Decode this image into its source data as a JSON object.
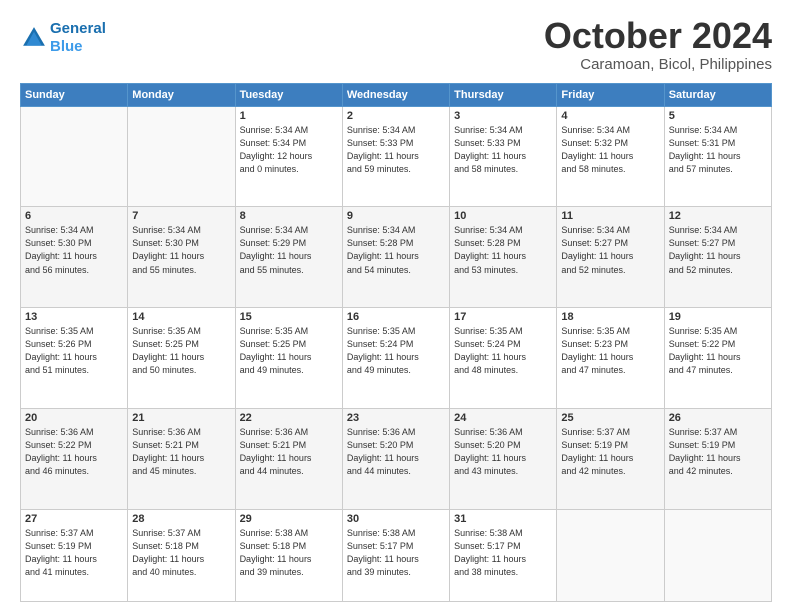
{
  "header": {
    "logo_line1": "General",
    "logo_line2": "Blue",
    "month": "October 2024",
    "location": "Caramoan, Bicol, Philippines"
  },
  "days_of_week": [
    "Sunday",
    "Monday",
    "Tuesday",
    "Wednesday",
    "Thursday",
    "Friday",
    "Saturday"
  ],
  "weeks": [
    [
      {
        "day": "",
        "info": ""
      },
      {
        "day": "",
        "info": ""
      },
      {
        "day": "1",
        "info": "Sunrise: 5:34 AM\nSunset: 5:34 PM\nDaylight: 12 hours\nand 0 minutes."
      },
      {
        "day": "2",
        "info": "Sunrise: 5:34 AM\nSunset: 5:33 PM\nDaylight: 11 hours\nand 59 minutes."
      },
      {
        "day": "3",
        "info": "Sunrise: 5:34 AM\nSunset: 5:33 PM\nDaylight: 11 hours\nand 58 minutes."
      },
      {
        "day": "4",
        "info": "Sunrise: 5:34 AM\nSunset: 5:32 PM\nDaylight: 11 hours\nand 58 minutes."
      },
      {
        "day": "5",
        "info": "Sunrise: 5:34 AM\nSunset: 5:31 PM\nDaylight: 11 hours\nand 57 minutes."
      }
    ],
    [
      {
        "day": "6",
        "info": "Sunrise: 5:34 AM\nSunset: 5:30 PM\nDaylight: 11 hours\nand 56 minutes."
      },
      {
        "day": "7",
        "info": "Sunrise: 5:34 AM\nSunset: 5:30 PM\nDaylight: 11 hours\nand 55 minutes."
      },
      {
        "day": "8",
        "info": "Sunrise: 5:34 AM\nSunset: 5:29 PM\nDaylight: 11 hours\nand 55 minutes."
      },
      {
        "day": "9",
        "info": "Sunrise: 5:34 AM\nSunset: 5:28 PM\nDaylight: 11 hours\nand 54 minutes."
      },
      {
        "day": "10",
        "info": "Sunrise: 5:34 AM\nSunset: 5:28 PM\nDaylight: 11 hours\nand 53 minutes."
      },
      {
        "day": "11",
        "info": "Sunrise: 5:34 AM\nSunset: 5:27 PM\nDaylight: 11 hours\nand 52 minutes."
      },
      {
        "day": "12",
        "info": "Sunrise: 5:34 AM\nSunset: 5:27 PM\nDaylight: 11 hours\nand 52 minutes."
      }
    ],
    [
      {
        "day": "13",
        "info": "Sunrise: 5:35 AM\nSunset: 5:26 PM\nDaylight: 11 hours\nand 51 minutes."
      },
      {
        "day": "14",
        "info": "Sunrise: 5:35 AM\nSunset: 5:25 PM\nDaylight: 11 hours\nand 50 minutes."
      },
      {
        "day": "15",
        "info": "Sunrise: 5:35 AM\nSunset: 5:25 PM\nDaylight: 11 hours\nand 49 minutes."
      },
      {
        "day": "16",
        "info": "Sunrise: 5:35 AM\nSunset: 5:24 PM\nDaylight: 11 hours\nand 49 minutes."
      },
      {
        "day": "17",
        "info": "Sunrise: 5:35 AM\nSunset: 5:24 PM\nDaylight: 11 hours\nand 48 minutes."
      },
      {
        "day": "18",
        "info": "Sunrise: 5:35 AM\nSunset: 5:23 PM\nDaylight: 11 hours\nand 47 minutes."
      },
      {
        "day": "19",
        "info": "Sunrise: 5:35 AM\nSunset: 5:22 PM\nDaylight: 11 hours\nand 47 minutes."
      }
    ],
    [
      {
        "day": "20",
        "info": "Sunrise: 5:36 AM\nSunset: 5:22 PM\nDaylight: 11 hours\nand 46 minutes."
      },
      {
        "day": "21",
        "info": "Sunrise: 5:36 AM\nSunset: 5:21 PM\nDaylight: 11 hours\nand 45 minutes."
      },
      {
        "day": "22",
        "info": "Sunrise: 5:36 AM\nSunset: 5:21 PM\nDaylight: 11 hours\nand 44 minutes."
      },
      {
        "day": "23",
        "info": "Sunrise: 5:36 AM\nSunset: 5:20 PM\nDaylight: 11 hours\nand 44 minutes."
      },
      {
        "day": "24",
        "info": "Sunrise: 5:36 AM\nSunset: 5:20 PM\nDaylight: 11 hours\nand 43 minutes."
      },
      {
        "day": "25",
        "info": "Sunrise: 5:37 AM\nSunset: 5:19 PM\nDaylight: 11 hours\nand 42 minutes."
      },
      {
        "day": "26",
        "info": "Sunrise: 5:37 AM\nSunset: 5:19 PM\nDaylight: 11 hours\nand 42 minutes."
      }
    ],
    [
      {
        "day": "27",
        "info": "Sunrise: 5:37 AM\nSunset: 5:19 PM\nDaylight: 11 hours\nand 41 minutes."
      },
      {
        "day": "28",
        "info": "Sunrise: 5:37 AM\nSunset: 5:18 PM\nDaylight: 11 hours\nand 40 minutes."
      },
      {
        "day": "29",
        "info": "Sunrise: 5:38 AM\nSunset: 5:18 PM\nDaylight: 11 hours\nand 39 minutes."
      },
      {
        "day": "30",
        "info": "Sunrise: 5:38 AM\nSunset: 5:17 PM\nDaylight: 11 hours\nand 39 minutes."
      },
      {
        "day": "31",
        "info": "Sunrise: 5:38 AM\nSunset: 5:17 PM\nDaylight: 11 hours\nand 38 minutes."
      },
      {
        "day": "",
        "info": ""
      },
      {
        "day": "",
        "info": ""
      }
    ]
  ]
}
